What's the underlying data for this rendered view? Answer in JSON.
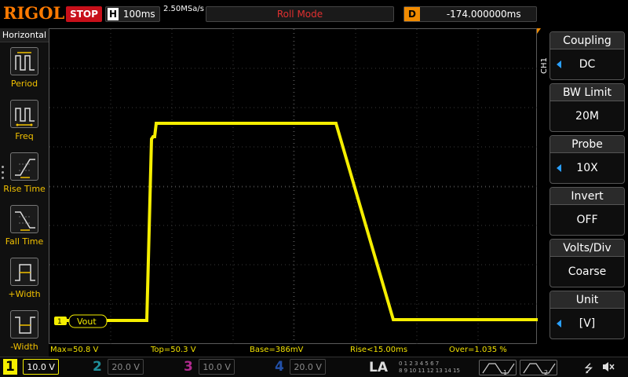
{
  "top": {
    "logo": "RIGOL",
    "run_state": "STOP",
    "h_label": "H",
    "timebase": "100ms",
    "sample_rate": "2.50MSa/s",
    "mode": "Roll Mode",
    "d_label": "D",
    "delay": "-174.000000ms"
  },
  "left_menu": {
    "title": "Horizontal",
    "items": [
      {
        "label": "Period",
        "icon": "period-icon"
      },
      {
        "label": "Freq",
        "icon": "freq-icon"
      },
      {
        "label": "Rise Time",
        "icon": "rise-time-icon"
      },
      {
        "label": "Fall Time",
        "icon": "fall-time-icon"
      },
      {
        "label": "+Width",
        "icon": "pos-width-icon"
      },
      {
        "label": "-Width",
        "icon": "neg-width-icon"
      }
    ]
  },
  "channel_tag": "CH1",
  "right_menu": [
    {
      "title": "Coupling",
      "value": "DC",
      "arrow": true
    },
    {
      "title": "BW Limit",
      "value": "20M",
      "arrow": false
    },
    {
      "title": "Probe",
      "value": "10X",
      "arrow": true
    },
    {
      "title": "Invert",
      "value": "OFF",
      "arrow": false
    },
    {
      "title": "Volts/Div",
      "value": "Coarse",
      "arrow": false
    },
    {
      "title": "Unit",
      "value": "[V]",
      "arrow": true
    }
  ],
  "trace": {
    "color": "#f5ee00",
    "marker_num": "1",
    "marker_label": "Vout"
  },
  "measurements": [
    {
      "text": "Max=50.8 V"
    },
    {
      "text": "Top=50.3 V"
    },
    {
      "text": "Base=386mV"
    },
    {
      "text": "Rise<15.00ms"
    },
    {
      "text": "Over=1.035 %"
    }
  ],
  "channels": [
    {
      "num": "1",
      "scale": "10.0 V",
      "color": "#f5ee00",
      "active": true
    },
    {
      "num": "2",
      "scale": "20.0 V",
      "color": "#1f8f9a",
      "active": false
    },
    {
      "num": "3",
      "scale": "10.0 V",
      "color": "#b02a8e",
      "active": false
    },
    {
      "num": "4",
      "scale": "20.0 V",
      "color": "#2250a8",
      "active": false
    }
  ],
  "la": {
    "label": "LA",
    "row1": "0 1 2 3  4 5 6 7",
    "row2": "8 9 10 11  12 13 14 15"
  },
  "decoders": [
    "1",
    "2"
  ]
}
